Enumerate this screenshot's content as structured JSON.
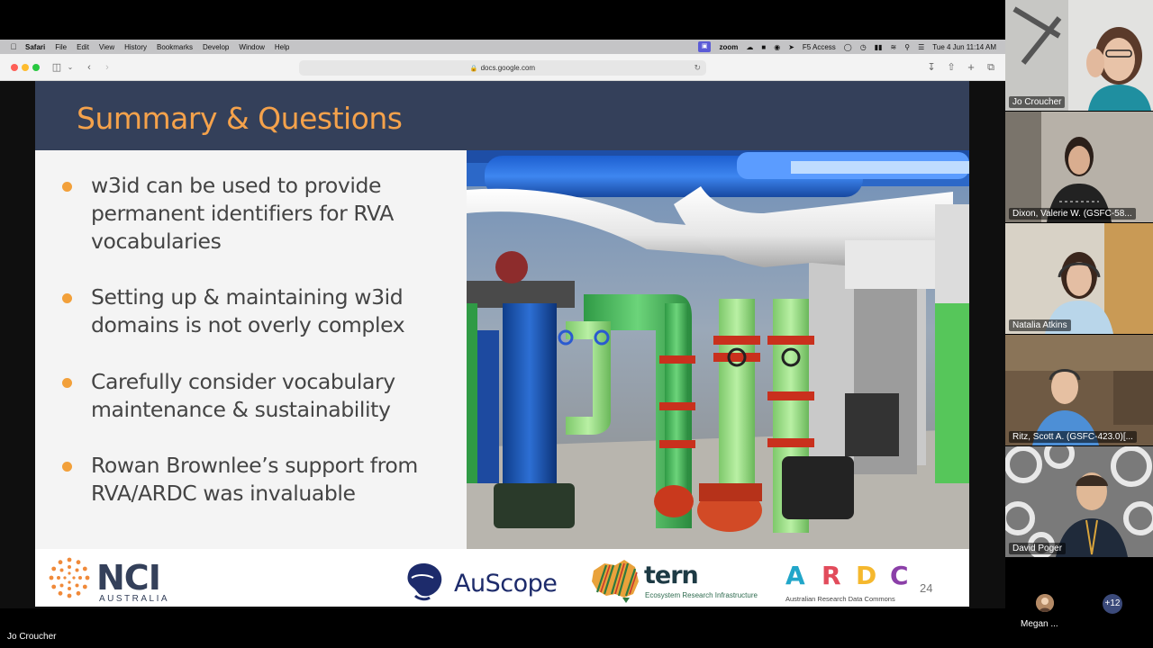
{
  "menubar": {
    "app": "Safari",
    "items": [
      "File",
      "Edit",
      "View",
      "History",
      "Bookmarks",
      "Develop",
      "Window",
      "Help"
    ],
    "zoom_label": "zoom",
    "f5_label": "F5 Access",
    "datetime": "Tue 4 Jun  11:14 AM"
  },
  "browser": {
    "url": "docs.google.com"
  },
  "slide": {
    "title": "Summary & Questions",
    "bullets": [
      "w3id can be used to provide permanent identifiers for RVA vocabularies",
      "Setting up & maintaining w3id domains is not overly complex",
      "Carefully consider vocabulary maintenance & sustainability",
      "Rowan Brownlee’s support from RVA/ARDC was invaluable"
    ],
    "footer": {
      "nci": "NCI",
      "nci_sub": "AUSTRALIA",
      "auscope": "AuScope",
      "tern": "tern",
      "tern_sub": "Ecosystem Research Infrastructure",
      "ardc_letters": [
        "A",
        "R",
        "D",
        "C"
      ],
      "ardc_sub": "Australian Research Data Commons",
      "page_number": "24"
    }
  },
  "participants": [
    {
      "name": "Jo Croucher"
    },
    {
      "name": "Dixon, Valerie W. (GSFC-58..."
    },
    {
      "name": "Natalia Atkins"
    },
    {
      "name": "Ritz, Scott A. (GSFC-423.0)[..."
    },
    {
      "name": "David Poger"
    }
  ],
  "more_participants": {
    "name": "Megan ...",
    "count": "+12"
  },
  "active_speaker": "Jo Croucher",
  "colors": {
    "slide_header": "#34405a",
    "title_accent": "#f5a24b",
    "bullet_dot": "#f2a03a"
  }
}
